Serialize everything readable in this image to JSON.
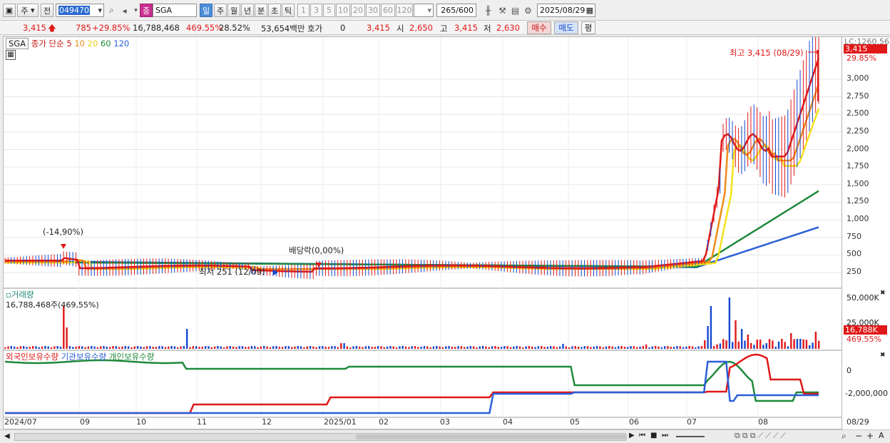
{
  "toolbar": {
    "market": "주",
    "prev_label": "전",
    "code": "049470",
    "name_tag": "종",
    "stock_name": "SGA",
    "periods": [
      "일",
      "주",
      "월",
      "년",
      "분",
      "초",
      "틱"
    ],
    "intervals": [
      "1",
      "3",
      "5",
      "10",
      "20",
      "30",
      "60",
      "120"
    ],
    "count_value": "265",
    "count_total": "/600",
    "date": "2025/08/29"
  },
  "quote": {
    "price": "3,415",
    "change": "785",
    "change_pct": "+29.85%",
    "volume": "16,788,468",
    "vol_ratio": "469.55%",
    "turnover": "28.52%",
    "amount": "53,654백만",
    "hoga_label": "호가",
    "hoga_value": "0",
    "ask": "3,415",
    "open_label": "시",
    "open": "2,650",
    "high_label": "고",
    "high": "3,415",
    "low_label": "저",
    "low": "2,630",
    "buy_label": "매수",
    "sell_label": "매도",
    "avg_label": "평"
  },
  "legend": {
    "symbol": "SGA",
    "title": "종가 단순",
    "ma": [
      "5",
      "10",
      "20",
      "60",
      "120"
    ]
  },
  "annotations": {
    "high_label": "최고 3,415 (08/29)",
    "low_label": "최저 251 (12/09)",
    "drop_label": "(-14,90%)",
    "dividend_label": "배당락(0,00%)",
    "right_top": "LC:1260.56",
    "right_price": "3,415",
    "right_pct": "29.85%"
  },
  "volume_panel": {
    "title": "거래량",
    "value": "16,788,468주(469,55%)",
    "tick_high": "50,000K",
    "tick_mid": "25,000K",
    "current": "16,788K",
    "current_pct": "469.55%"
  },
  "holdings_panel": {
    "legend": [
      "외국인보유수량",
      "기관보유수량",
      "개인보유수량"
    ],
    "tick_zero": "0",
    "tick_neg": "-2,000,000"
  },
  "xaxis": [
    "2024/07",
    "09",
    "10",
    "11",
    "12",
    "2025/01",
    "02",
    "03",
    "04",
    "05",
    "06",
    "07",
    "08",
    "08/29"
  ],
  "price_ticks": [
    "3,000",
    "2,750",
    "2,500",
    "2,250",
    "2,000",
    "1,750",
    "1,500",
    "1,250",
    "1,000",
    "750",
    "500",
    "250"
  ],
  "colors": {
    "up": "#e01818",
    "down": "#1448d0",
    "ma5": "#e01818",
    "ma10": "#f08c1a",
    "ma20": "#f5e21a",
    "ma60": "#1f8a3c",
    "ma120": "#2a5fd8"
  }
}
